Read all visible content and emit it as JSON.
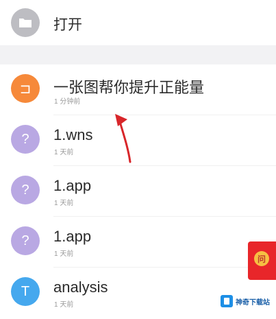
{
  "open_row": {
    "label": "打开",
    "icon": "folder-icon",
    "icon_color": "#bdbdc2"
  },
  "files": [
    {
      "name": "一张图帮你提升正能量",
      "time": "1 分钟前",
      "icon": "file-icon",
      "badge": "⊐",
      "color": "#f6893a"
    },
    {
      "name": "1.wns",
      "time": "1 天前",
      "icon": "unknown-file-icon",
      "badge": "?",
      "color": "#b9a8e3"
    },
    {
      "name": "1.app",
      "time": "1 天前",
      "icon": "unknown-file-icon",
      "badge": "?",
      "color": "#b9a8e3"
    },
    {
      "name": "1.app",
      "time": "1 天前",
      "icon": "unknown-file-icon",
      "badge": "?",
      "color": "#b9a8e3"
    },
    {
      "name": "analysis",
      "time": "1 天前",
      "icon": "text-file-icon",
      "badge": "T",
      "color": "#45a8ee"
    }
  ],
  "red_packet": {
    "label": "问"
  },
  "watermark": {
    "text": "神奇下载站"
  }
}
